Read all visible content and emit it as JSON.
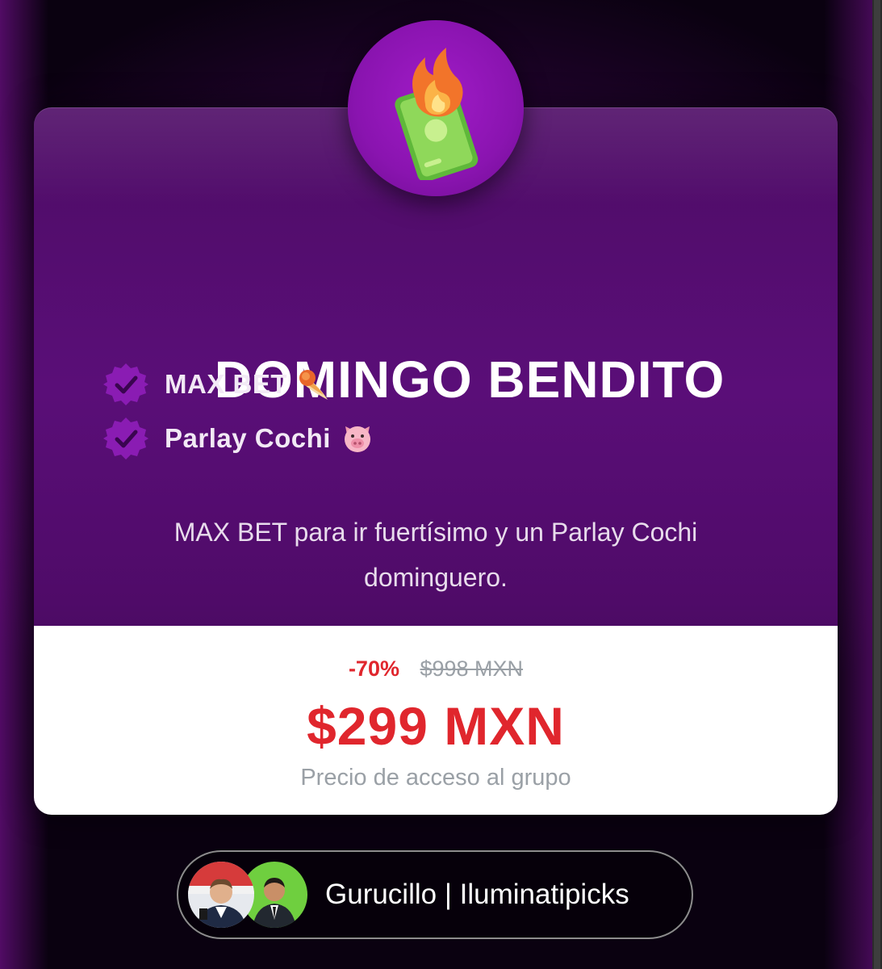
{
  "promo": {
    "title": "DOMINGO BENDITO",
    "icon": "money-on-fire-icon",
    "features": [
      {
        "label": "MAX BET",
        "icon": "comet-icon"
      },
      {
        "label": "Parlay Cochi",
        "icon": "pig-face-icon"
      }
    ],
    "description": "MAX BET para ir fuertísimo y un Parlay Cochi dominguero."
  },
  "pricing": {
    "discount": "-70%",
    "original_price": "$998 MXN",
    "price": "$299 MXN",
    "caption": "Precio de acceso al grupo"
  },
  "author": {
    "name": "Gurucillo | Iluminatipicks",
    "avatars": [
      "avatar-gurucillo",
      "avatar-iluminatipicks"
    ]
  },
  "colors": {
    "accent_purple": "#8a14b0",
    "price_red": "#e0262d",
    "caption_gray": "#9aa0a6"
  }
}
